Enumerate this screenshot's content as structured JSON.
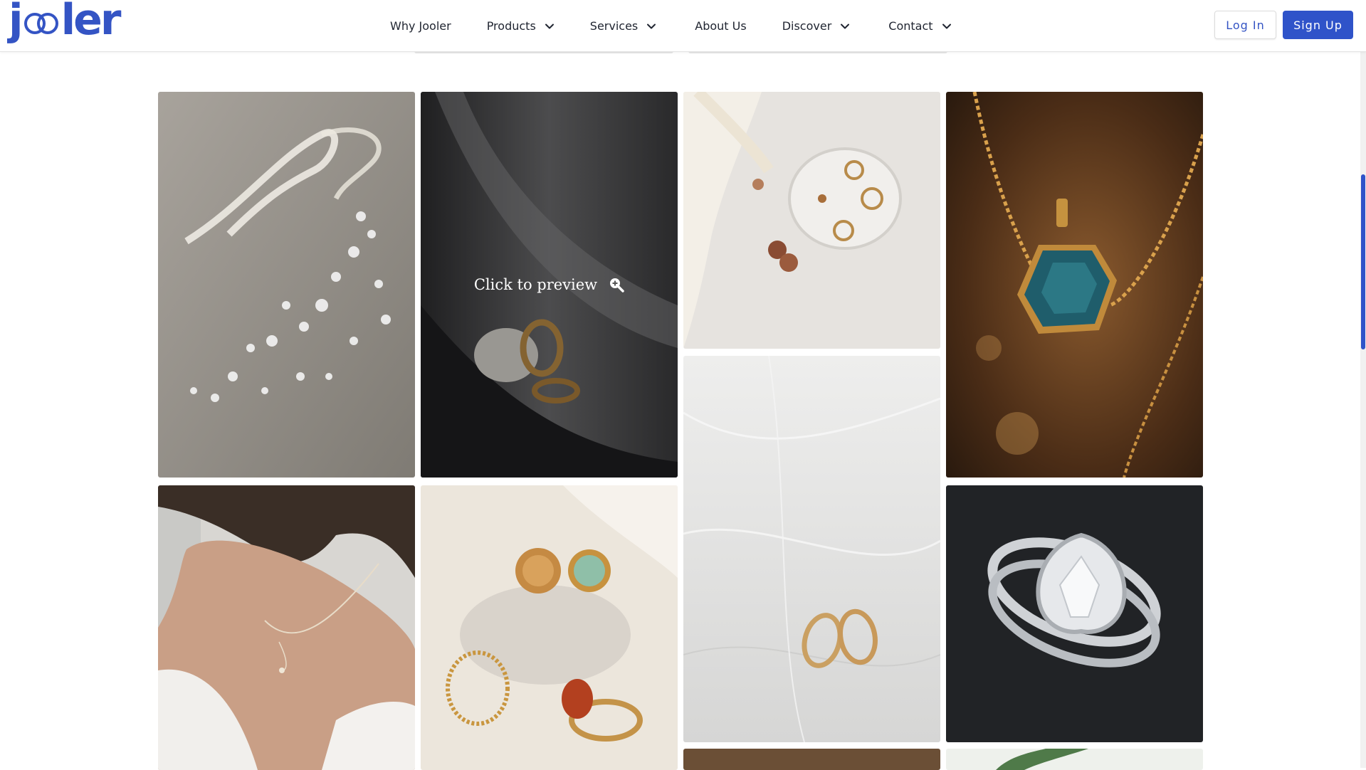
{
  "brand": {
    "logo_text": "jooler",
    "logo_color": "#3454c4"
  },
  "nav": {
    "items": [
      {
        "label": "Why Jooler",
        "has_dropdown": false
      },
      {
        "label": "Products",
        "has_dropdown": true
      },
      {
        "label": "Services",
        "has_dropdown": true
      },
      {
        "label": "About Us",
        "has_dropdown": false
      },
      {
        "label": "Discover",
        "has_dropdown": true
      },
      {
        "label": "Contact",
        "has_dropdown": true
      }
    ]
  },
  "auth": {
    "login_label": "Log In",
    "signup_label": "Sign Up",
    "accent": "#2f53c9"
  },
  "gallery": {
    "preview_text": "Click to preview",
    "preview_icon": "zoom-in-icon",
    "images": [
      {
        "subject": "crystal-hairpiece"
      },
      {
        "subject": "gold-rings-on-stone-dark"
      },
      {
        "subject": "earrings-in-dish"
      },
      {
        "subject": "teal-gem-pendant"
      },
      {
        "subject": "wedding-bands-on-veil"
      },
      {
        "subject": "woman-wearing-necklace"
      },
      {
        "subject": "gemstone-rings-on-stone"
      },
      {
        "subject": "diamond-halo-ring"
      }
    ]
  }
}
